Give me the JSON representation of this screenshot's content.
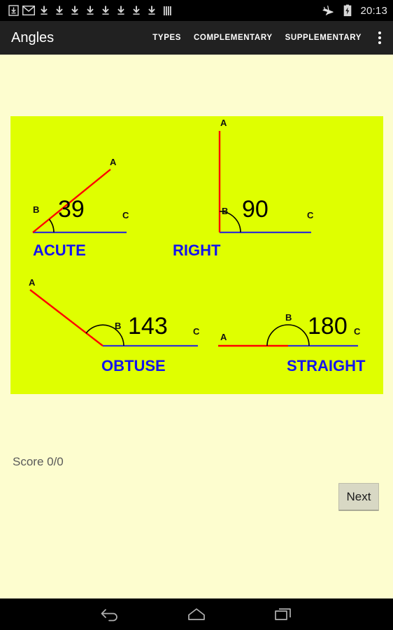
{
  "status_bar": {
    "icons": [
      "download-box-icon",
      "gmail-icon",
      "download-arrow-icon",
      "download-arrow-icon",
      "download-arrow-icon",
      "download-arrow-icon",
      "download-arrow-icon",
      "download-arrow-icon",
      "download-arrow-icon",
      "download-arrow-icon",
      "equalizer-bars-icon"
    ],
    "airplane_icon": "airplane-mode-icon",
    "battery_icon": "battery-charging-icon",
    "clock": "20:13"
  },
  "action_bar": {
    "title": "Angles",
    "tabs": [
      {
        "label": "TYPES"
      },
      {
        "label": "COMPLEMENTARY"
      },
      {
        "label": "SUPPLEMENTARY"
      }
    ],
    "overflow_icon": "overflow-menu-icon"
  },
  "canvas": {
    "background_color": "#DFFF00",
    "vertex_label_a": "A",
    "vertex_label_b": "B",
    "vertex_label_c": "C",
    "angles": [
      {
        "id": "acute",
        "degrees": "39",
        "type_label": "ACUTE",
        "ray_color": "#FF0000",
        "base_color": "#3333CC",
        "label_color": "#1414EE"
      },
      {
        "id": "right",
        "degrees": "90",
        "type_label": "RIGHT",
        "ray_color": "#FF0000",
        "base_color": "#3333CC",
        "label_color": "#1414EE"
      },
      {
        "id": "obtuse",
        "degrees": "143",
        "type_label": "OBTUSE",
        "ray_color": "#FF0000",
        "base_color": "#3333CC",
        "label_color": "#1414EE"
      },
      {
        "id": "straight",
        "degrees": "180",
        "type_label": "STRAIGHT",
        "ray_color": "#FF0000",
        "base_color": "#3333CC",
        "label_color": "#1414EE"
      }
    ]
  },
  "score": {
    "text": "Score 0/0"
  },
  "next_button": {
    "label": "Next"
  },
  "nav_bar": {
    "back_icon": "back-arrow-icon",
    "home_icon": "home-icon",
    "recents_icon": "recent-apps-icon"
  }
}
